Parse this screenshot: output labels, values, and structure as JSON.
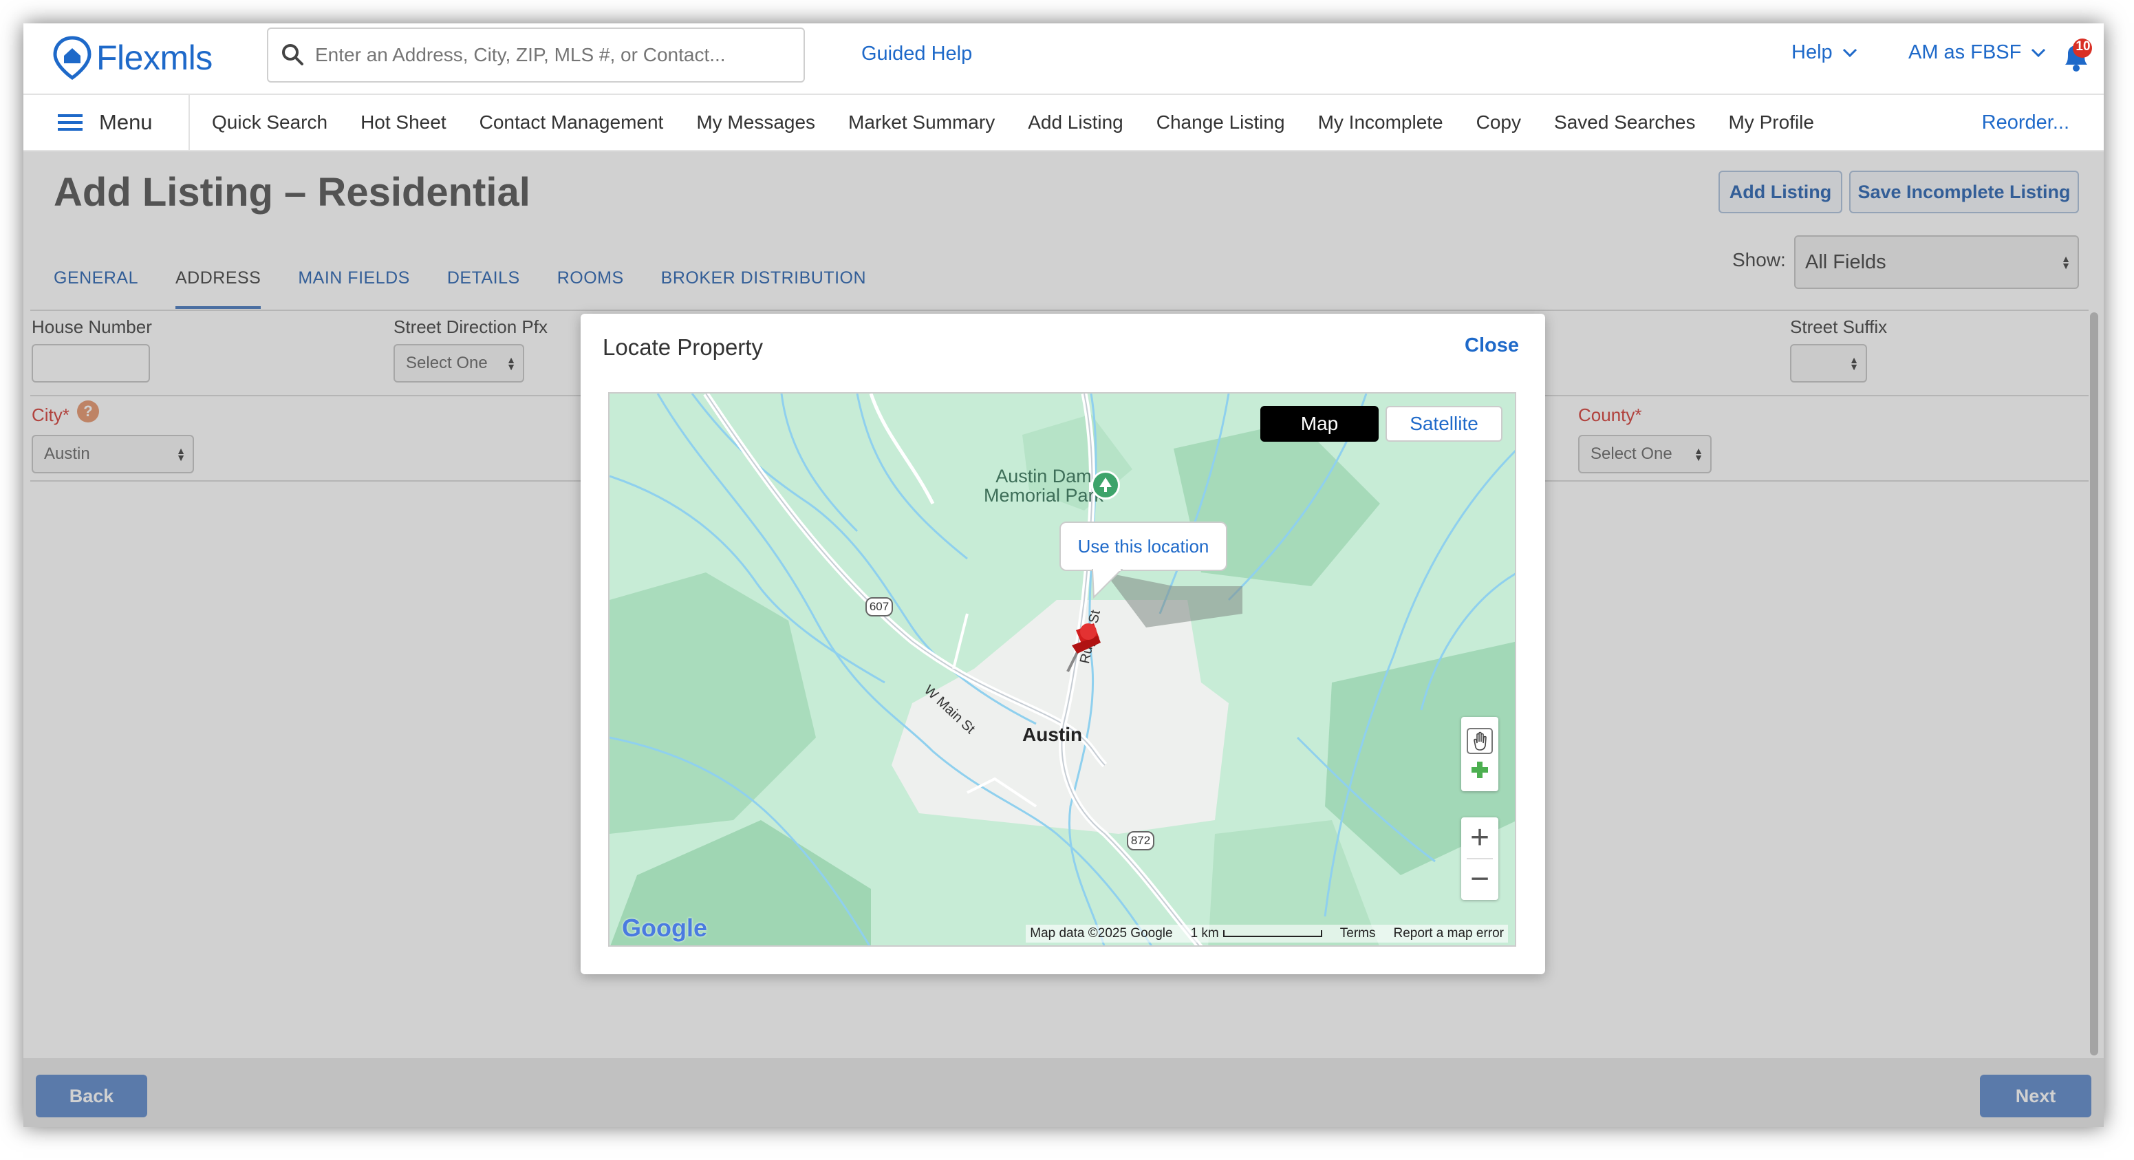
{
  "topbar": {
    "logo_text": "Flexmls",
    "search_placeholder": "Enter an Address, City, ZIP, MLS #, or Contact...",
    "guided_help": "Guided Help",
    "help_label": "Help",
    "user_label": "AM as FBSF",
    "notification_count": "10"
  },
  "nav": {
    "menu_label": "Menu",
    "items": [
      {
        "label": "Quick Search"
      },
      {
        "label": "Hot Sheet"
      },
      {
        "label": "Contact Management"
      },
      {
        "label": "My Messages"
      },
      {
        "label": "Market Summary"
      },
      {
        "label": "Add Listing"
      },
      {
        "label": "Change Listing"
      },
      {
        "label": "My Incomplete"
      },
      {
        "label": "Copy"
      },
      {
        "label": "Saved Searches"
      },
      {
        "label": "My Profile"
      }
    ],
    "reorder": "Reorder..."
  },
  "page": {
    "title": "Add Listing – Residential",
    "add_listing_btn": "Add Listing",
    "save_incomplete_btn": "Save Incomplete Listing",
    "show_label": "Show:",
    "show_value": "All Fields"
  },
  "tabs": [
    {
      "label": "GENERAL"
    },
    {
      "label": "ADDRESS"
    },
    {
      "label": "MAIN FIELDS"
    },
    {
      "label": "DETAILS"
    },
    {
      "label": "ROOMS"
    },
    {
      "label": "BROKER DISTRIBUTION"
    }
  ],
  "form": {
    "house_number_label": "House Number",
    "house_number_value": "",
    "street_dir_label": "Street Direction Pfx",
    "street_dir_value": "Select One",
    "street_suffix_label": "Street Suffix",
    "street_suffix_value": "",
    "city_label": "City*",
    "city_value": "Austin",
    "county_label": "County*",
    "county_value": "Select One"
  },
  "footer": {
    "back": "Back",
    "next": "Next"
  },
  "modal": {
    "title": "Locate Property",
    "close": "Close",
    "map_btn": "Map",
    "satellite_btn": "Satellite",
    "tooltip": "Use this location",
    "park_label_1": "Austin Dam",
    "park_label_2": "Memorial Park",
    "town_label": "Austin",
    "road_607": "607",
    "road_872": "872",
    "street_main": "W Main St",
    "street_ruger": "Ruger St",
    "google": "Google",
    "map_data": "Map data ©2025 Google",
    "scale": "1 km",
    "terms": "Terms",
    "report": "Report a map error"
  },
  "colors": {
    "brand": "#1e69c9",
    "required": "#d8514b",
    "footer_button": "#6e95d0"
  }
}
